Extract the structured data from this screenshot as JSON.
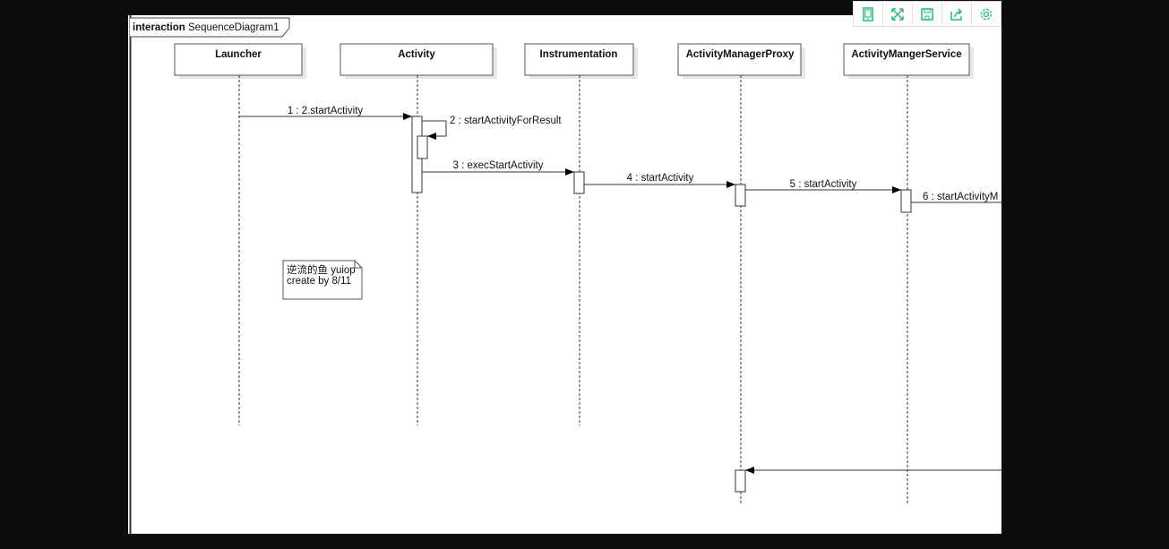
{
  "frame": {
    "keyword": "interaction",
    "name": "SequenceDiagram1"
  },
  "lifelines": [
    {
      "name": "Launcher"
    },
    {
      "name": "Activity"
    },
    {
      "name": "Instrumentation"
    },
    {
      "name": "ActivityManagerProxy"
    },
    {
      "name": "ActivityMangerService"
    }
  ],
  "messages": [
    {
      "label": "1 : 2.startActivity",
      "from": "Launcher",
      "to": "Activity"
    },
    {
      "label": "2 : startActivityForResult",
      "from": "Activity",
      "to": "Activity"
    },
    {
      "label": "3 : execStartActivity",
      "from": "Activity",
      "to": "Instrumentation"
    },
    {
      "label": "4 : startActivity",
      "from": "Instrumentation",
      "to": "ActivityManagerProxy"
    },
    {
      "label": "5 : startActivity",
      "from": "ActivityManagerProxy",
      "to": "ActivityMangerService"
    },
    {
      "label": "6 : startActivityM",
      "from": "ActivityMangerService",
      "to": ""
    }
  ],
  "note": {
    "line1": "逆流的鱼 yuiop",
    "line2": "create by 8/11"
  },
  "toolbar": [
    {
      "icon": "tablet-icon"
    },
    {
      "icon": "fullscreen-icon"
    },
    {
      "icon": "save-icon"
    },
    {
      "icon": "share-icon"
    },
    {
      "icon": "settings-icon"
    }
  ],
  "colors": {
    "toolbar_icon": "#1dbf73",
    "background": "#0d0d0d"
  }
}
